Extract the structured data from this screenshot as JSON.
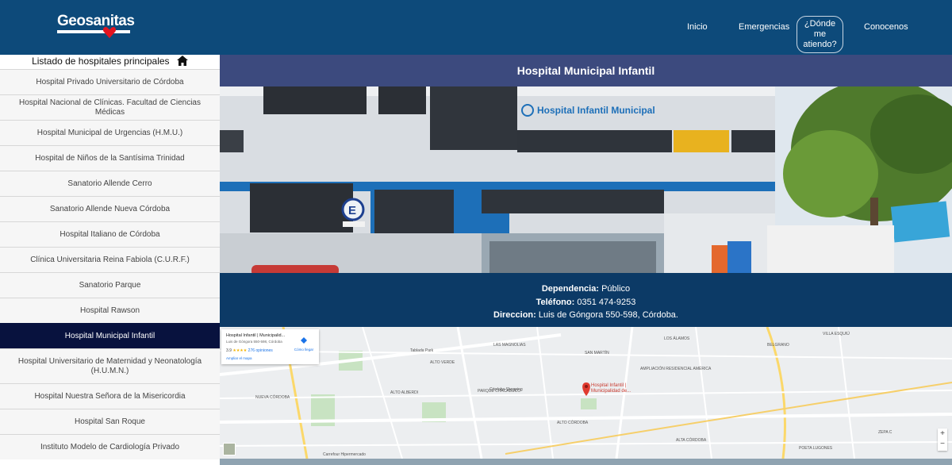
{
  "header": {
    "logo_text": "Geosanitas",
    "nav": [
      {
        "label": "Inicio"
      },
      {
        "label": "Emergencias"
      },
      {
        "label": "¿Dónde me atiendo?"
      },
      {
        "label": "Conocenos"
      }
    ]
  },
  "sidebar": {
    "title": "Listado de hospitales principales",
    "items": [
      {
        "label": "Hospital Privado Universitario de Córdoba"
      },
      {
        "label": "Hospital Nacional de Clínicas. Facultad de Ciencias Médicas"
      },
      {
        "label": "Hospital Municipal de Urgencias (H.M.U.)"
      },
      {
        "label": "Hospital de Niños de la Santísima Trinidad"
      },
      {
        "label": "Sanatorio Allende Cerro"
      },
      {
        "label": "Sanatorio Allende Nueva Córdoba"
      },
      {
        "label": "Hospital Italiano de Córdoba"
      },
      {
        "label": "Clínica Universitaria Reina Fabiola (C.U.R.F.)"
      },
      {
        "label": "Sanatorio Parque"
      },
      {
        "label": "Hospital Rawson"
      },
      {
        "label": "Hospital Municipal Infantil"
      },
      {
        "label": "Hospital Universitario de Maternidad y Neonatología (H.U.M.N.)"
      },
      {
        "label": "Hospital Nuestra Señora de la Misericordia"
      },
      {
        "label": "Hospital San Roque"
      },
      {
        "label": "Instituto Modelo de Cardiología Privado"
      }
    ],
    "active_index": 10
  },
  "main": {
    "title": "Hospital Municipal Infantil",
    "photo_sign": "Hospital Infantil Municipal",
    "info": {
      "dependencia_label": "Dependencia:",
      "dependencia_value": "Público",
      "telefono_label": "Teléfono:",
      "telefono_value": "0351 474-9253",
      "direccion_label": "Direccion:",
      "direccion_value": "Luis de Góngora 550-598, Córdoba."
    },
    "map": {
      "card_title": "Hospital Infantil | Municipalid...",
      "card_address": "Luis de Góngora 550-598, Córdoba",
      "card_rating": "3.9",
      "card_reviews": "276 opiniones",
      "card_link": "Ampliar el mapa",
      "directions": "Cómo llegar",
      "pin_label": "Hospital Infantil | Municipalidad de...",
      "zoom_in": "+",
      "zoom_out": "−",
      "labels": [
        {
          "text": "ALTO VERDE"
        },
        {
          "text": "LAS MAGNOLIAS"
        },
        {
          "text": "SAN MARTÍN"
        },
        {
          "text": "ALTO ALBERDI"
        },
        {
          "text": "PARQUE CHACABUCO"
        },
        {
          "text": "ALTO CÓRDOBA"
        },
        {
          "text": "NUEVA CÓRDOBA"
        },
        {
          "text": "BELGRANO"
        },
        {
          "text": "ALTA CÓRDOBA"
        },
        {
          "text": "AMPLIACIÓN RESIDENCIAL AMÉRICA"
        },
        {
          "text": "VILLA ESQUIÚ"
        },
        {
          "text": "LOS ÁLAMOS"
        },
        {
          "text": "ZEPA C"
        },
        {
          "text": "POETA LUGONES"
        },
        {
          "text": "Tablada Park"
        },
        {
          "text": "Córdoba Shopping"
        },
        {
          "text": "Carrefour Hipermercado"
        }
      ]
    }
  }
}
